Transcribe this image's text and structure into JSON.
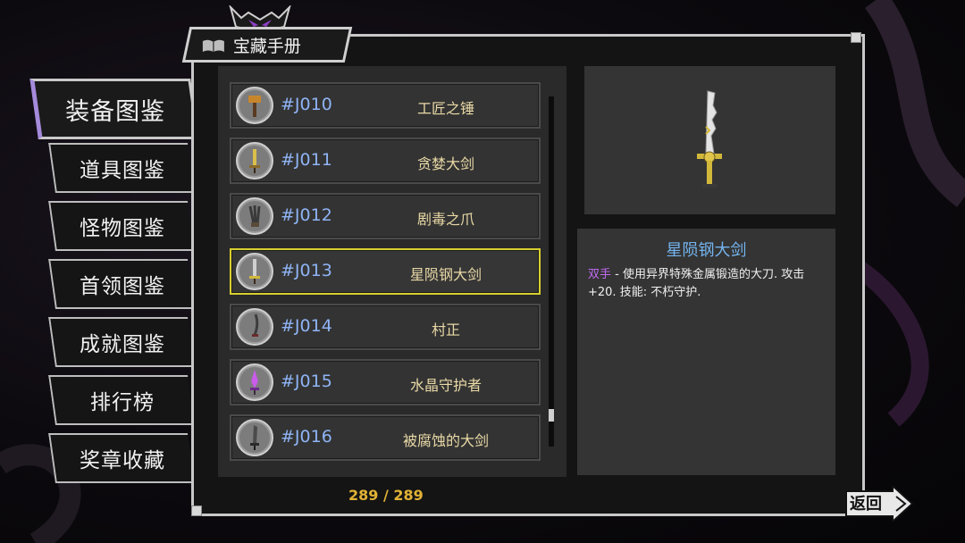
{
  "header": {
    "title": "宝藏手册",
    "book_icon": "book-wings-icon",
    "emblem": "demon-emblem-icon"
  },
  "tabs": [
    {
      "label": "装备图鉴",
      "active": true
    },
    {
      "label": "道具图鉴",
      "active": false
    },
    {
      "label": "怪物图鉴",
      "active": false
    },
    {
      "label": "首领图鉴",
      "active": false
    },
    {
      "label": "成就图鉴",
      "active": false
    },
    {
      "label": "排行榜",
      "active": false
    },
    {
      "label": "奖章收藏",
      "active": false
    }
  ],
  "list": {
    "items": [
      {
        "code": "#J010",
        "name": "工匠之锤",
        "icon": "hammer-icon"
      },
      {
        "code": "#J011",
        "name": "贪婪大剑",
        "icon": "greatsword-icon"
      },
      {
        "code": "#J012",
        "name": "剧毒之爪",
        "icon": "claw-icon"
      },
      {
        "code": "#J013",
        "name": "星陨钢大剑",
        "icon": "greatsword-icon",
        "selected": true
      },
      {
        "code": "#J014",
        "name": "村正",
        "icon": "katana-icon"
      },
      {
        "code": "#J015",
        "name": "水晶守护者",
        "icon": "crystal-sword-icon"
      },
      {
        "code": "#J016",
        "name": "被腐蚀的大剑",
        "icon": "greatsword-icon"
      }
    ],
    "count": "289 / 289"
  },
  "detail": {
    "title": "星陨钢大剑",
    "keyword": "双手",
    "description": " - 使用异界特殊金属锻造的大刀. 攻击+20. 技能: 不朽守护.",
    "preview_icon": "greatsword-icon"
  },
  "back_button": {
    "label": "返回"
  },
  "colors": {
    "code": "#8fb4f5",
    "name": "#e9d9a6",
    "selected_border": "#d8cf2f",
    "detail_title": "#74b4ee",
    "keyword": "#c06bf0",
    "count": "#e1b235",
    "tab_accent": "#a58adb"
  }
}
